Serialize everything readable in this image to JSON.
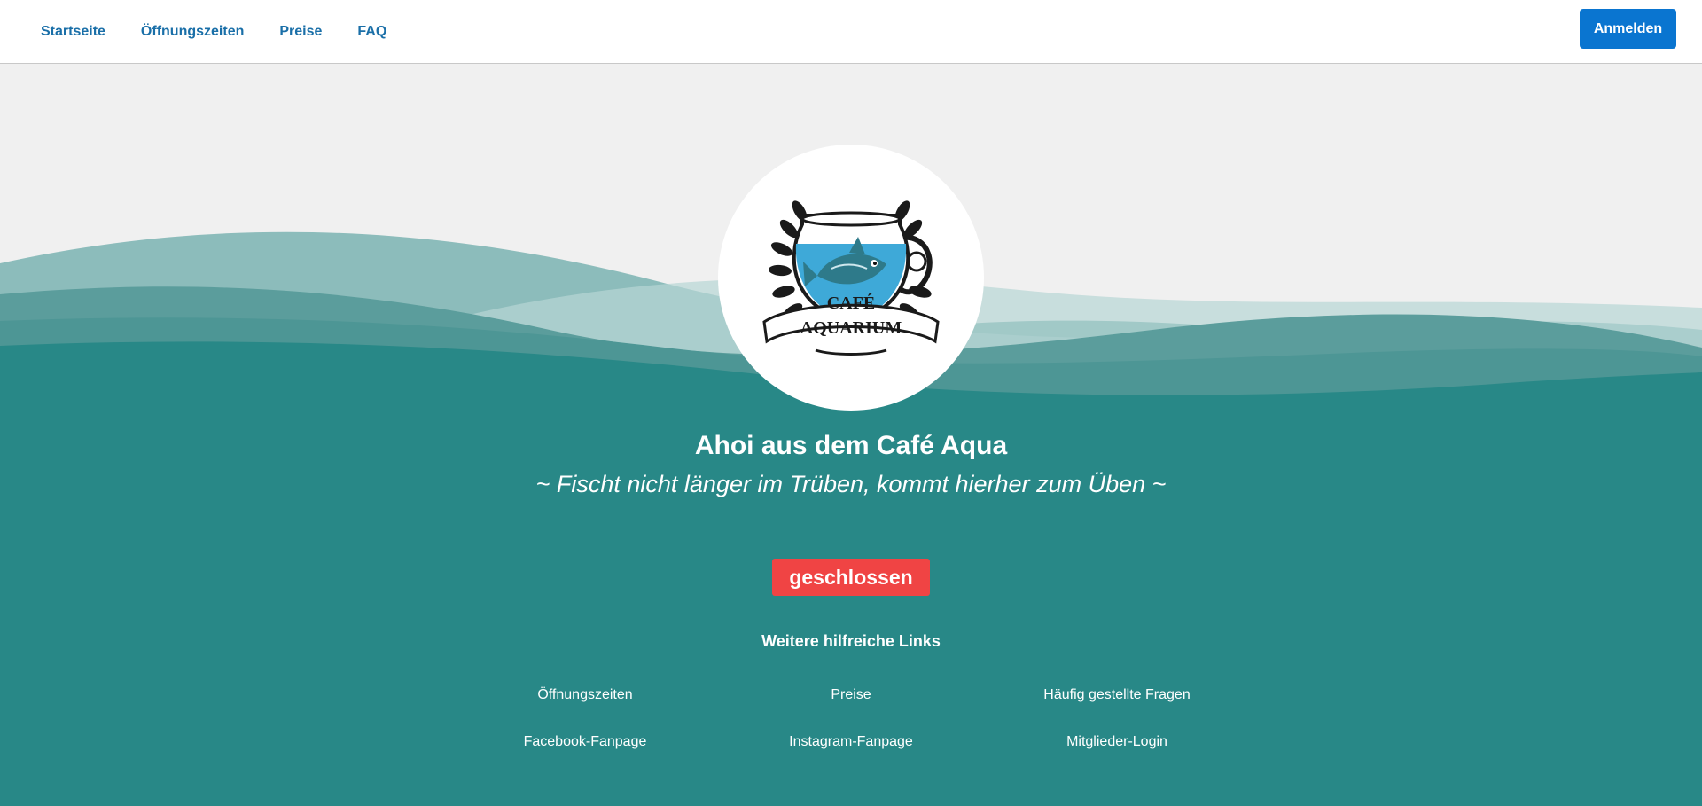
{
  "nav": {
    "items": [
      {
        "label": "Startseite"
      },
      {
        "label": "Öffnungszeiten"
      },
      {
        "label": "Preise"
      },
      {
        "label": "FAQ"
      }
    ],
    "login_label": "Anmelden"
  },
  "colors": {
    "nav_link": "#1a6fa8",
    "login_button": "#0a75d0",
    "background_top": "#f0f0f0",
    "teal": "#288887",
    "status_badge": "#f04444"
  },
  "logo": {
    "icon": "cafe-aquarium-logo",
    "text_line1": "CAFÉ",
    "text_line2": "AQUARIUM"
  },
  "hero": {
    "title": "Ahoi aus dem Café Aqua",
    "subtitle": "~ Fischt nicht länger im Trüben, kommt hierher zum Üben ~",
    "status": "geschlossen"
  },
  "links": {
    "heading": "Weitere hilfreiche Links",
    "items": [
      {
        "label": "Öffnungszeiten"
      },
      {
        "label": "Preise"
      },
      {
        "label": "Häufig gestellte Fragen"
      },
      {
        "label": "Facebook-Fanpage"
      },
      {
        "label": "Instagram-Fanpage"
      },
      {
        "label": "Mitglieder-Login"
      }
    ]
  }
}
